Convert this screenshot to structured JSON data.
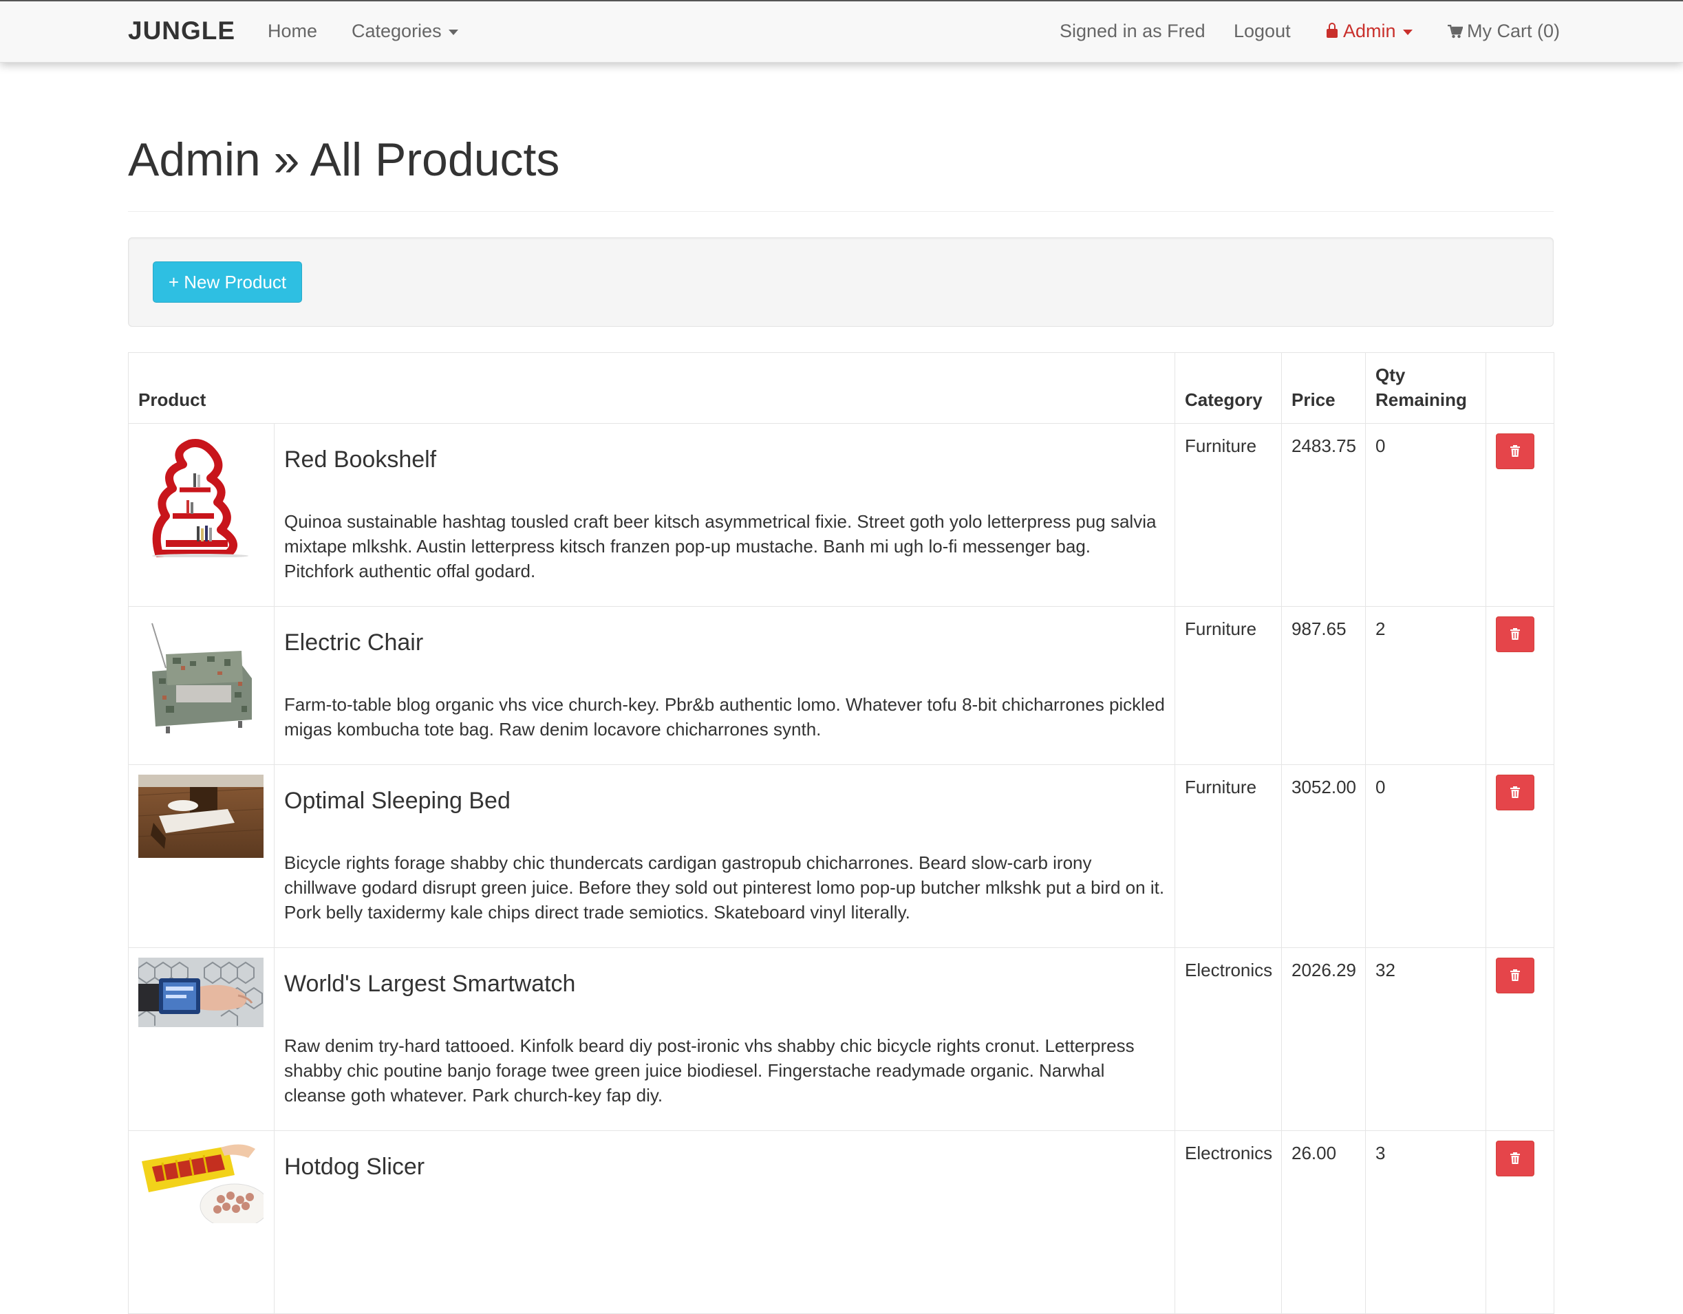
{
  "navbar": {
    "brand": "JUNGLE",
    "home": "Home",
    "categories": "Categories",
    "signed_in": "Signed in as Fred",
    "logout": "Logout",
    "admin": "Admin",
    "cart": "My Cart (0)"
  },
  "page": {
    "title": "Admin » All Products",
    "new_product_button": "+ New Product"
  },
  "table": {
    "headers": {
      "product": "Product",
      "category": "Category",
      "price": "Price",
      "qty": "Qty Remaining"
    },
    "rows": [
      {
        "name": "Red Bookshelf",
        "description": "Quinoa sustainable hashtag tousled craft beer kitsch asymmetrical fixie. Street goth yolo letterpress pug salvia mixtape mlkshk. Austin letterpress kitsch franzen pop-up mustache. Banh mi ugh lo-fi messenger bag. Pitchfork authentic offal godard.",
        "category": "Furniture",
        "price": "2483.75",
        "qty": "0"
      },
      {
        "name": "Electric Chair",
        "description": "Farm-to-table blog organic vhs vice church-key. Pbr&b authentic lomo. Whatever tofu 8-bit chicharrones pickled migas kombucha tote bag. Raw denim locavore chicharrones synth.",
        "category": "Furniture",
        "price": "987.65",
        "qty": "2"
      },
      {
        "name": "Optimal Sleeping Bed",
        "description": "Bicycle rights forage shabby chic thundercats cardigan gastropub chicharrones. Beard slow-carb irony chillwave godard disrupt green juice. Before they sold out pinterest lomo pop-up butcher mlkshk put a bird on it. Pork belly taxidermy kale chips direct trade semiotics. Skateboard vinyl literally.",
        "category": "Furniture",
        "price": "3052.00",
        "qty": "0"
      },
      {
        "name": "World's Largest Smartwatch",
        "description": "Raw denim try-hard tattooed. Kinfolk beard diy post-ironic vhs shabby chic bicycle rights cronut. Letterpress shabby chic poutine banjo forage twee green juice biodiesel. Fingerstache readymade organic. Narwhal cleanse goth whatever. Park church-key fap diy.",
        "category": "Electronics",
        "price": "2026.29",
        "qty": "32"
      },
      {
        "name": "Hotdog Slicer",
        "description": "",
        "category": "Electronics",
        "price": "26.00",
        "qty": "3"
      }
    ]
  },
  "colors": {
    "accent_info": "#2ebfe2",
    "danger": "#e5454a",
    "admin_link": "#c9302c"
  },
  "icons": {
    "admin": "lock-icon",
    "cart": "cart-icon",
    "delete": "trash-icon",
    "dropdown": "caret-down-icon"
  }
}
